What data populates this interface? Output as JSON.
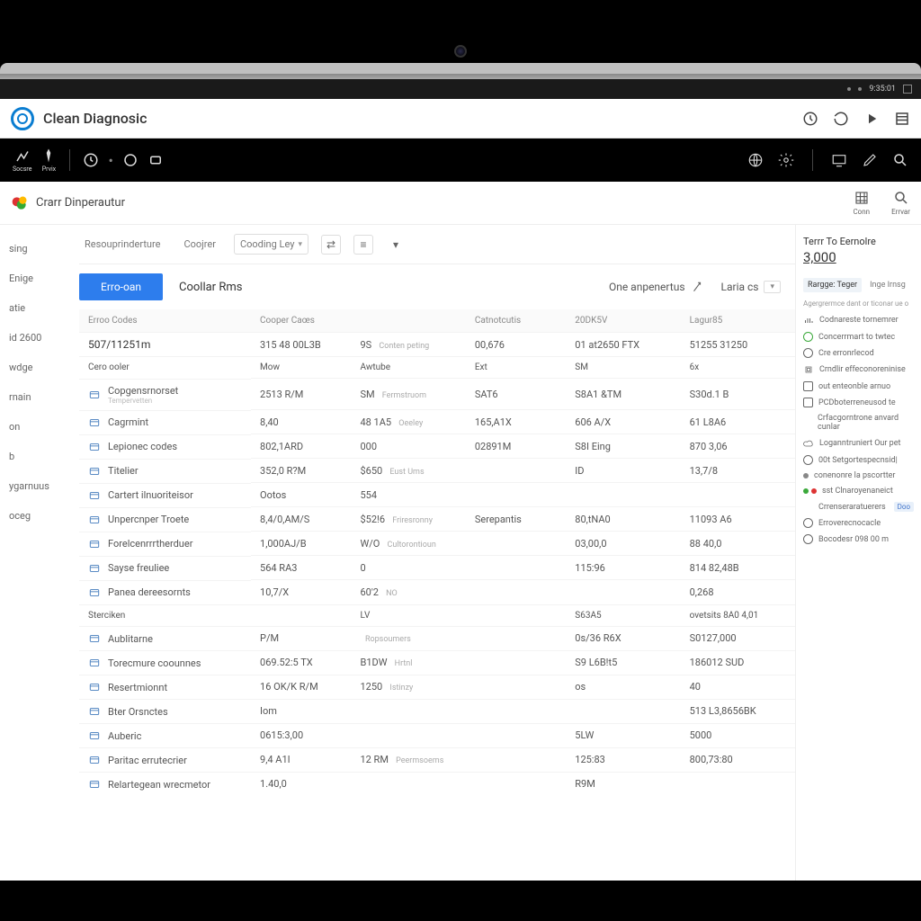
{
  "sysbar": {
    "time": "9:35:01"
  },
  "titlebar": {
    "app": "Clean Diagnosic"
  },
  "subheader": {
    "title": "Crarr Dinperautur",
    "right": [
      {
        "id": "grid",
        "label": "Conn"
      },
      {
        "id": "search",
        "label": "Errvar"
      }
    ]
  },
  "sidebar": {
    "items": [
      {
        "label": "sing"
      },
      {
        "label": "Enige"
      },
      {
        "label": "atie"
      },
      {
        "label": "id 2600"
      },
      {
        "label": "wdge"
      },
      {
        "label": "rnain"
      },
      {
        "label": "on"
      },
      {
        "label": "b"
      },
      {
        "label": "ygarnuus"
      },
      {
        "label": "oceg"
      }
    ]
  },
  "tabs": {
    "t1": "Resouprinderture",
    "t2": "Coojrer",
    "t3": "Cooding Ley"
  },
  "filter": {
    "active": "Erro-oan",
    "col": "Coollar Rms",
    "right1": "One anpenertus",
    "right2": "Laria cs"
  },
  "headers": {
    "c1": "Erroo Codes",
    "c2": "Cooper Caœs",
    "c3": "",
    "c4": "Catnotcutis",
    "c5": "20DK5V",
    "c6": "Lagur85"
  },
  "summaryRow": {
    "c1": "507/11251m",
    "c2": "315 48 00L3B",
    "c3": "9S",
    "c3b": "Conten peting",
    "c4": "00,676",
    "c5": "01 at2650 FTX",
    "c6": "51255 31250"
  },
  "subhdr": {
    "c1": "Cero ooler",
    "c2": "Mow",
    "c3": "Awtube",
    "c4": "Ext",
    "c5": "SM",
    "c6": "6x"
  },
  "rows": [
    {
      "name": "Copgensrnorset",
      "sub": "Tempervetten",
      "c2": "2513 R/M",
      "c3": "SM",
      "c3b": "Fermstruom",
      "c4": "SAT6",
      "c5": "S8A1 &TM",
      "c6": "S30d.1 B"
    },
    {
      "name": "Cagrmint",
      "c2": "8,40",
      "c3": "48 1A5",
      "c3b": "Oeeley",
      "c4": "165,A1X",
      "c5": "606 A/X",
      "c6": "61 L8A6"
    },
    {
      "name": "Lepionec codes",
      "c2": "802,1ARD",
      "c3": "000",
      "c4": "02891M",
      "c5": "S8I Eing",
      "c6": "870 3,06"
    },
    {
      "name": "Titelier",
      "c2": "352,0 R?M",
      "c3": "$650",
      "c3b": "Eust Ums",
      "c4": "",
      "c5": "ID",
      "c6": "13,7/8"
    },
    {
      "name": "Cartert ilnuoriteisor",
      "c2": "Ootos",
      "c3": "554",
      "c4": "",
      "c5": "",
      "c6": ""
    },
    {
      "name": "Unpercnper Troete",
      "c2": "8,4/0,AM/S",
      "c3": "$52!6",
      "c3b": "Friresronny",
      "c4": "Serepantis",
      "c5": "80,tNA0",
      "c6": "11093 A6"
    },
    {
      "name": "Forelcenrrrtherduer",
      "c2": "1,000AJ/B",
      "c3": "W/O",
      "c3b": "Cultorontioun",
      "c4": "",
      "c5": "03,00,0",
      "c6": "88 40,0"
    },
    {
      "name": "Sayse freuliee",
      "c2": "564 RA3",
      "c3": "0",
      "c4": "",
      "c5": "115:96",
      "c6": "814 82,48B"
    },
    {
      "name": "Panea dereesornts",
      "c2": "10,7/X",
      "c3": "60'2",
      "c3b": "NO",
      "c4": "",
      "c5": "",
      "c6": "0,268"
    }
  ],
  "section2": {
    "hdr": "Sterciken",
    "sub": "LV",
    "c5": "S63A5",
    "c6": "ovetsits 8A0 4,01"
  },
  "rows2": [
    {
      "name": "Aublitarne",
      "c2": "P/M",
      "c3": "",
      "c3b": "Ropsoumers",
      "c4": "",
      "c5": "0s/36 R6X",
      "c6": "S0127,000"
    },
    {
      "name": "Torecmure coounnes",
      "c2": "069.52:5 TX",
      "c3": "B1DW",
      "c3b": "Hrtnl",
      "c4": "",
      "c5": "S9 L6B!t5",
      "c6": "186012 SUD"
    },
    {
      "name": "Resertmionnt",
      "c2": "16 OK/K R/M",
      "c3": "1250",
      "c3b": "Istinzy",
      "c4": "",
      "c5": "os",
      "c6": "40"
    },
    {
      "name": "Bter Orsnctes",
      "c2": "Iom",
      "c3": "",
      "c4": "",
      "c5": "",
      "c6": "513 L3,8656BK"
    },
    {
      "name": "Auberic",
      "c2": "0615:3,00",
      "c3": "",
      "c4": "",
      "c5": "5LW",
      "c6": "5000"
    },
    {
      "name": "Paritac errutecrier",
      "c2": "9,4 A1I",
      "c3": "12 RM",
      "c3b": "Peermsoems",
      "c4": "",
      "c5": "125:83",
      "c6": "800,73:80"
    },
    {
      "name": "Relartegean wrecmetor",
      "c2": "1.40,0",
      "c3": "",
      "c4": "",
      "c5": "R9M",
      "c6": ""
    }
  ],
  "rightpanel": {
    "title": "Terrr To Eernolre",
    "big": "3,000",
    "tabs": [
      "Rargge: Teger",
      "Inge Irnsg"
    ],
    "subtitle": "Agergrermce dant or ticonar ue o",
    "items": [
      {
        "ico": "bars",
        "t": "Codnareste tornemrer"
      },
      {
        "ico": "ring-g",
        "t": "Concerrmart to twtec"
      },
      {
        "ico": "ring",
        "t": "Cre erronrlecod"
      },
      {
        "ico": "chip",
        "t": "Crndlir effeconoreninise"
      },
      {
        "ico": "sq",
        "t": "out enteonble arnuo"
      },
      {
        "ico": "sq",
        "t": "PCDboterreneusod te"
      },
      {
        "ico": "txt",
        "t": "Crfacgorntrone anvard cunlar"
      },
      {
        "ico": "cloud",
        "t": "Loganntruniert Our pet"
      },
      {
        "ico": "ring",
        "t": "00t Setgortespecnsid|"
      },
      {
        "ico": "dot",
        "t": "conenonre la pscortter"
      },
      {
        "ico": "dot-gr",
        "t": "sst Clnaroyenaneict"
      },
      {
        "ico": "txt",
        "t": "Crrenseraratuerers",
        "badge": "Doo"
      },
      {
        "ico": "ring",
        "t": "Erroverecnocacle"
      },
      {
        "ico": "ring",
        "t": "Bocodesr 098 00 m"
      }
    ]
  }
}
